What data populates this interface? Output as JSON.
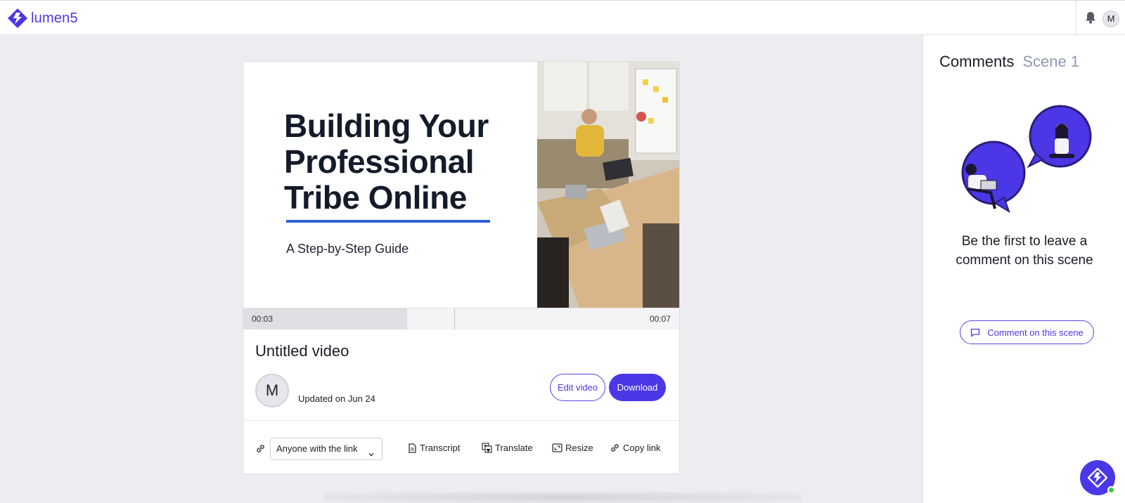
{
  "app": {
    "name": "lumen5",
    "brand_color": "#4b37e6"
  },
  "topbar": {
    "avatar_initial": "M"
  },
  "preview": {
    "title_lines": [
      "Building Your",
      "Professional",
      "Tribe Online"
    ],
    "subtitle": "A Step-by-Step Guide",
    "progress": 0.375
  },
  "timeline": {
    "start": "00:03",
    "end": "00:07"
  },
  "video": {
    "title": "Untitled video",
    "owner_initial": "M",
    "updated": "Updated on Jun 24",
    "edit_label": "Edit video",
    "download_label": "Download"
  },
  "share": {
    "visibility": "Anyone with the link",
    "actions": {
      "transcript": "Transcript",
      "translate": "Translate",
      "resize": "Resize",
      "copy": "Copy link"
    }
  },
  "comments": {
    "title": "Comments",
    "scene": "Scene 1",
    "empty_message": "Be the first to leave a comment on this scene",
    "button_label": "Comment on this scene"
  }
}
